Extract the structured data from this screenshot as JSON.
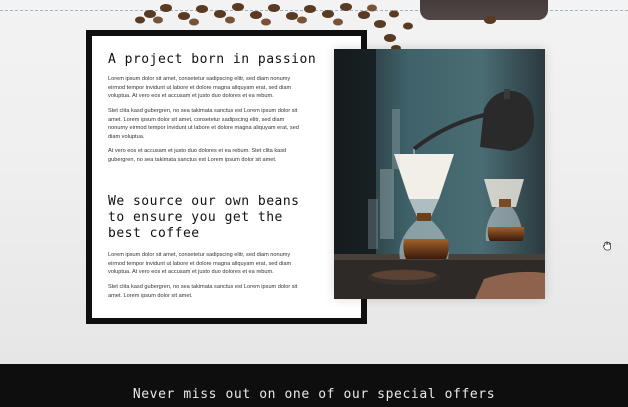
{
  "section1": {
    "title": "A project born in passion",
    "p1": "Lorem ipsum dolor sit amet, consetetur sadipscing elitr, sed diam nonumy eirmod tempor invidunt ut labore et dolore magna aliquyam erat, sed diam voluptua. At vero eos et accusam et justo duo dolores et ea rebum.",
    "p2": "Stet clita kasd gubergren, no sea takimata sanctus est Lorem ipsum dolor sit amet. Lorem ipsum dolor sit amet, consetetur sadipscing elitr, sed diam nonumy eirmod tempor invidunt ut labore et dolore magna aliquyam erat, sed diam voluptua.",
    "p3": "At vero eos et accusam et justo duo dolores et ea rebum. Stet clita kasd gubergren, no sea takimata sanctus est Lorem ipsum dolor sit amet."
  },
  "section2": {
    "title_line1": "We source our own beans",
    "title_line2": "to ensure you get the",
    "title_line3": "best coffee",
    "p1": "Lorem ipsum dolor sit amet, consetetur sadipscing elitr, sed diam nonumy eirmod tempor invidunt ut labore et dolore magna aliquyam erat, sed diam voluptua. At vero eos et accusam et justo duo dolores et ea rebum.",
    "p2": "Stet clita kasd gubergren, no sea takimata sanctus est Lorem ipsum dolor sit amet. Lorem ipsum dolor sit amet."
  },
  "footer": {
    "title": "Never miss out on one of our special offers"
  },
  "icons": {
    "cursor": "hand-grab-icon"
  },
  "colors": {
    "card_border": "#0f0f0f",
    "footer_bg": "#0e0e0e",
    "footer_text": "#e8e8e8",
    "page_bg": "#f0f0f0"
  }
}
